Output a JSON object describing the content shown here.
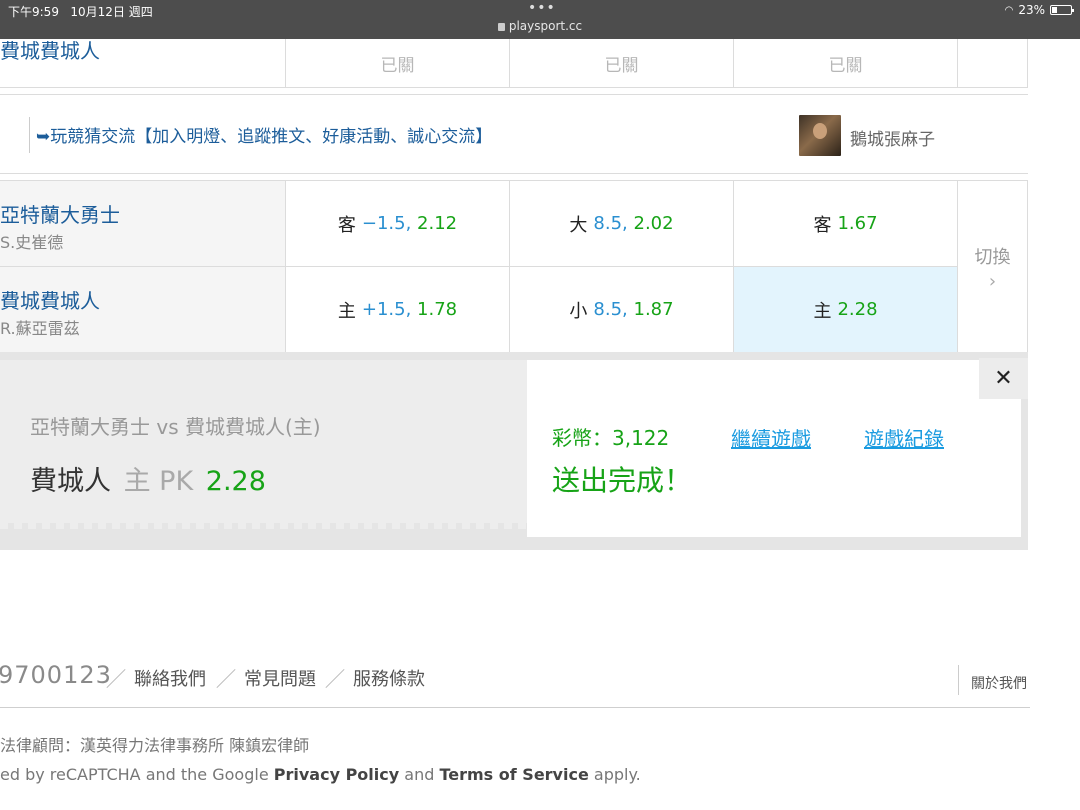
{
  "status_bar": {
    "time": "下午9:59",
    "date": "10月12日 週四",
    "dots": "•••",
    "url": "playsport.cc",
    "battery": "23%"
  },
  "closed_row": {
    "team": "費城費城人",
    "cells": [
      "已關",
      "已關",
      "已關"
    ]
  },
  "forum": {
    "link": "➥玩競猜交流【加入明燈、追蹤推文、好康活動、誠心交流】",
    "author": "鵝城張麻子"
  },
  "odds": {
    "rows": [
      {
        "team": "亞特蘭大勇士",
        "pitcher": "S.史崔德",
        "spread": {
          "label": "客",
          "line": "−1.5,",
          "odds": "2.12"
        },
        "total": {
          "label": "大",
          "line": "8.5,",
          "odds": "2.02"
        },
        "moneyline": {
          "label": "客",
          "odds": "1.67"
        }
      },
      {
        "team": "費城費城人",
        "pitcher": "R.蘇亞雷茲",
        "spread": {
          "label": "主",
          "line": "+1.5,",
          "odds": "1.78"
        },
        "total": {
          "label": "小",
          "line": "8.5,",
          "odds": "1.87"
        },
        "moneyline": {
          "label": "主",
          "odds": "2.28"
        }
      }
    ],
    "switch_label": "切換",
    "switch_icon": "chevron-right-icon"
  },
  "confirm": {
    "match": "亞特蘭大勇士 vs 費城費城人(主)",
    "pick_team": "費城人",
    "pick_type": "主 PK",
    "pick_odds": "2.28",
    "coins": "彩幣：3,122",
    "continue_label": "繼續遊戲",
    "history_label": "遊戲紀錄",
    "done": "送出完成！",
    "close_icon": "close-icon"
  },
  "footer": {
    "phone": "9700123",
    "links": [
      "聯絡我們",
      "常見問題",
      "服務條款"
    ],
    "about": "關於我們",
    "legal": "法律顧問：漢英得力法律事務所 陳鎮宏律師",
    "captcha_prefix": "ed by reCAPTCHA and the Google",
    "privacy": "Privacy Policy",
    "and": "and",
    "terms": "Terms of Service",
    "apply": "apply."
  },
  "colors": {
    "team_blue": "#1c5d9a",
    "odds_green": "#17a317",
    "line_blue": "#2a8fd0",
    "link_blue": "#1a9be0",
    "selected_bg": "#e3f4fd"
  }
}
